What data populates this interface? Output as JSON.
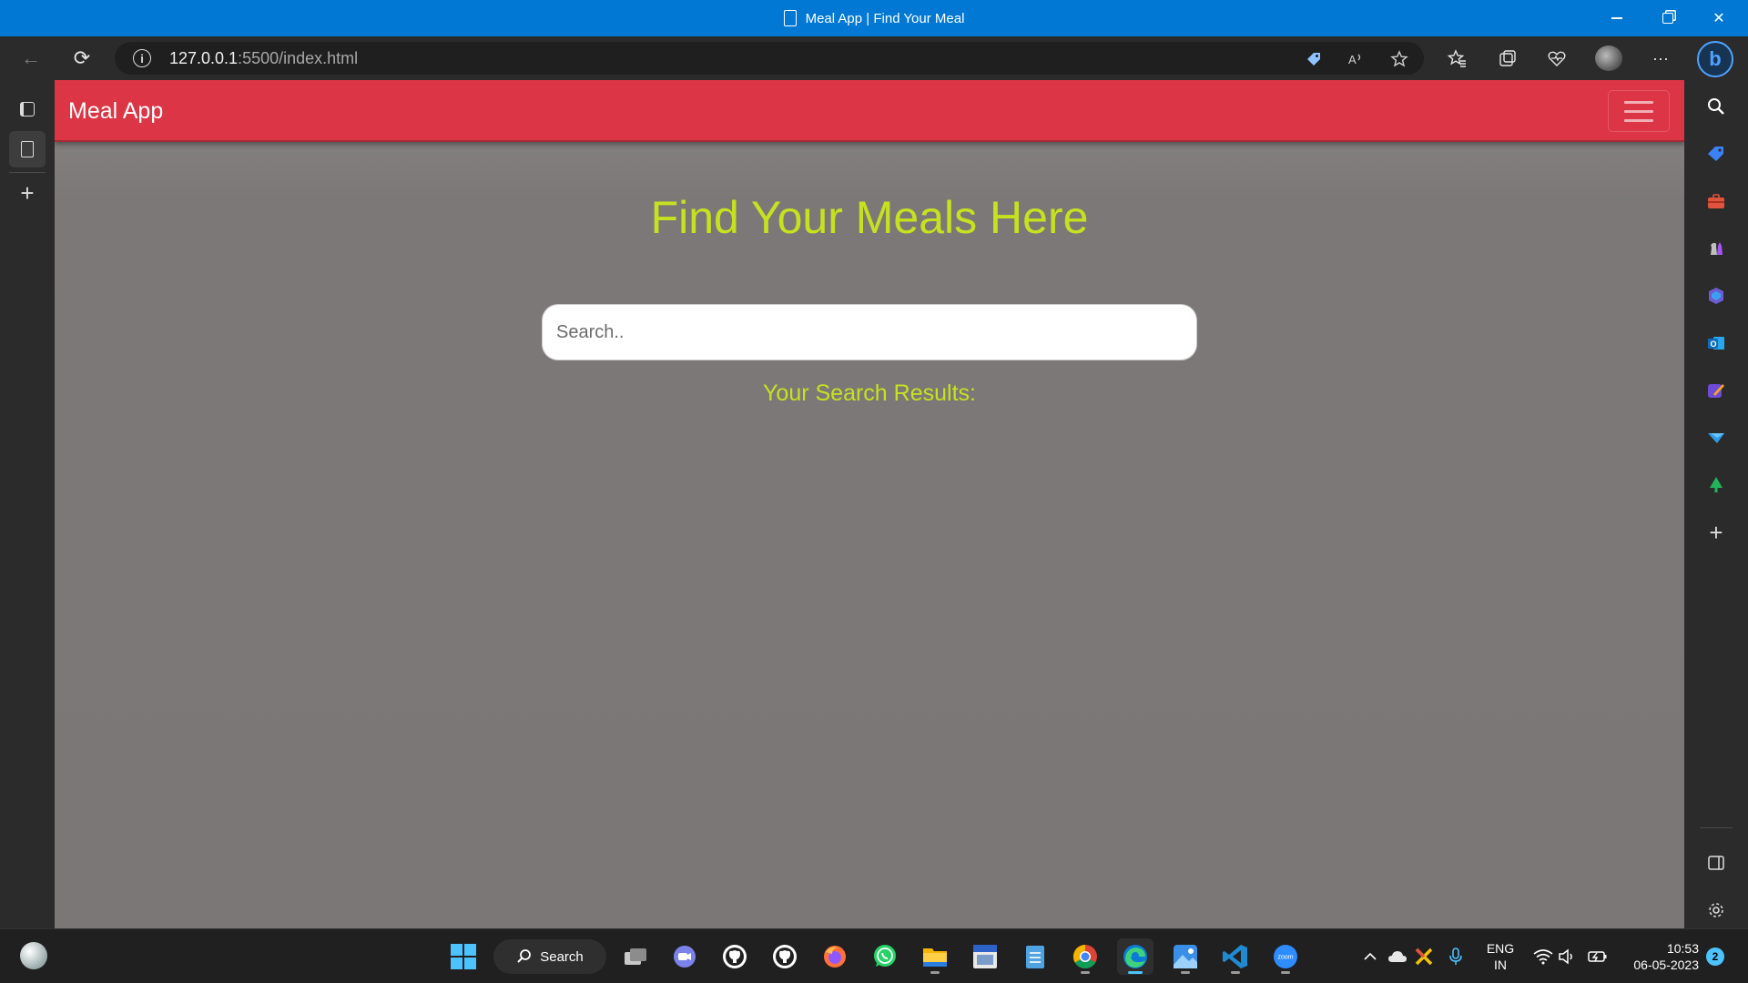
{
  "window": {
    "title": "Meal App | Find Your Meal",
    "minimize_glyph": "—",
    "close_glyph": "✕"
  },
  "browser": {
    "url_host": "127.0.0.1",
    "url_path": ":5500/index.html",
    "back_glyph": "←",
    "refresh_glyph": "⟳",
    "more_glyph": "···",
    "bing_glyph": "b",
    "toolbar_icons": [
      "coupon-tag-icon",
      "read-aloud-icon",
      "add-favorite-icon",
      "favorites-icon",
      "collections-icon",
      "browser-essentials-icon",
      "profile-avatar",
      "settings-more-icon",
      "bing-copilot-icon"
    ]
  },
  "left_strip": {
    "icons": [
      "tab-actions-icon",
      "vertical-tab-page-icon",
      "new-tab-plus-icon"
    ],
    "plus_glyph": "+"
  },
  "right_sidebar": {
    "icons": [
      "search-icon",
      "shopping-icon",
      "tools-icon",
      "games-icon",
      "microsoft-365-icon",
      "outlook-icon",
      "designer-icon",
      "drop-icon",
      "tree-icon",
      "add-app-icon",
      "sidebar-toggle-icon",
      "gear-icon"
    ],
    "plus_glyph": "+"
  },
  "page": {
    "brand": "Meal App",
    "heading": "Find Your Meals Here",
    "search_placeholder": "Search..",
    "results_label": "Your Search Results:",
    "accent_color": "#c6e21f",
    "navbar_color": "#dc3545"
  },
  "taskbar": {
    "search_label": "Search",
    "apps": [
      "start-icon",
      "taskview-icon",
      "teams-chat-icon",
      "github-desktop-icon",
      "github-icon",
      "firefox-icon",
      "whatsapp-icon",
      "file-explorer-icon",
      "app-icon",
      "notepad-icon",
      "chrome-icon",
      "edge-icon",
      "photos-icon",
      "vscode-icon",
      "zoom-icon"
    ],
    "lang_top": "ENG",
    "lang_bottom": "IN",
    "time": "10:53",
    "date": "06-05-2023",
    "notifications": "2"
  }
}
